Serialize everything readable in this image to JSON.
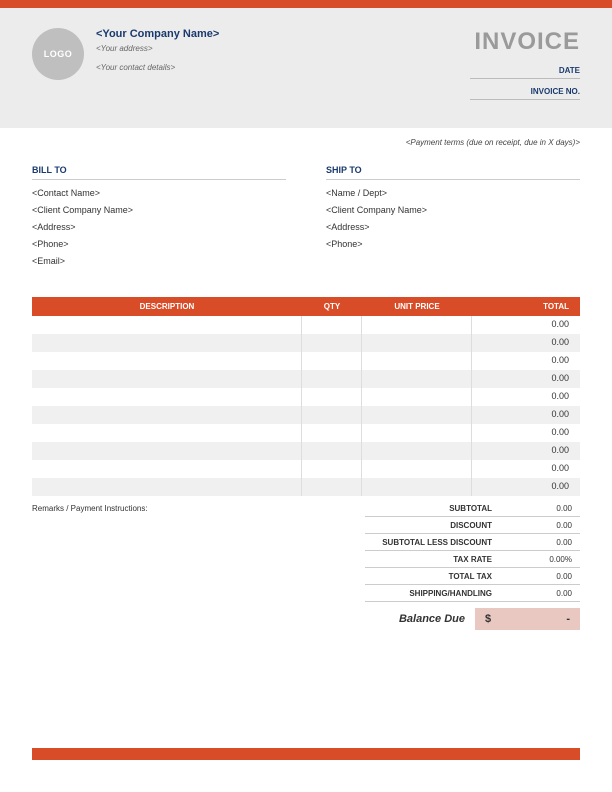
{
  "header": {
    "logo_text": "LOGO",
    "company_name": "<Your Company Name>",
    "address": "<Your address>",
    "contact": "<Your contact details>",
    "invoice_title": "INVOICE",
    "date_label": "DATE",
    "invoice_no_label": "INVOICE NO."
  },
  "payment_terms": "<Payment terms (due on receipt, due in X days)>",
  "bill_to": {
    "title": "BILL TO",
    "lines": [
      "<Contact Name>",
      "<Client Company Name>",
      "<Address>",
      "<Phone>",
      "<Email>"
    ]
  },
  "ship_to": {
    "title": "SHIP TO",
    "lines": [
      "<Name / Dept>",
      "<Client Company Name>",
      "<Address>",
      "<Phone>"
    ]
  },
  "columns": {
    "desc": "DESCRIPTION",
    "qty": "QTY",
    "price": "UNIT PRICE",
    "total": "TOTAL"
  },
  "rows": [
    {
      "desc": "",
      "qty": "",
      "price": "",
      "total": "0.00"
    },
    {
      "desc": "",
      "qty": "",
      "price": "",
      "total": "0.00"
    },
    {
      "desc": "",
      "qty": "",
      "price": "",
      "total": "0.00"
    },
    {
      "desc": "",
      "qty": "",
      "price": "",
      "total": "0.00"
    },
    {
      "desc": "",
      "qty": "",
      "price": "",
      "total": "0.00"
    },
    {
      "desc": "",
      "qty": "",
      "price": "",
      "total": "0.00"
    },
    {
      "desc": "",
      "qty": "",
      "price": "",
      "total": "0.00"
    },
    {
      "desc": "",
      "qty": "",
      "price": "",
      "total": "0.00"
    },
    {
      "desc": "",
      "qty": "",
      "price": "",
      "total": "0.00"
    },
    {
      "desc": "",
      "qty": "",
      "price": "",
      "total": "0.00"
    }
  ],
  "remarks_label": "Remarks / Payment Instructions:",
  "totals": {
    "subtotal": {
      "label": "SUBTOTAL",
      "value": "0.00"
    },
    "discount": {
      "label": "DISCOUNT",
      "value": "0.00"
    },
    "subtotal_less": {
      "label": "SUBTOTAL LESS DISCOUNT",
      "value": "0.00"
    },
    "tax_rate": {
      "label": "TAX RATE",
      "value": "0.00%"
    },
    "total_tax": {
      "label": "TOTAL TAX",
      "value": "0.00"
    },
    "shipping": {
      "label": "SHIPPING/HANDLING",
      "value": "0.00"
    }
  },
  "balance": {
    "label": "Balance Due",
    "currency": "$",
    "value": "-"
  }
}
